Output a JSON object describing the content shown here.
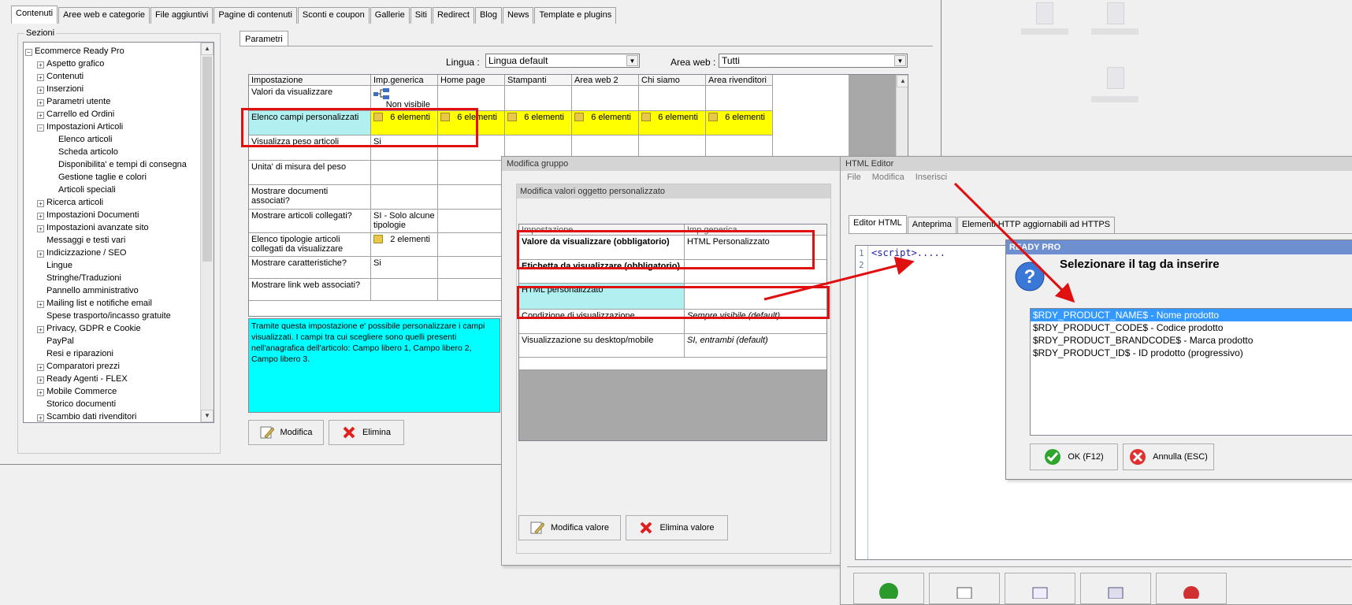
{
  "main": {
    "tabs": [
      "Contenuti",
      "Aree web e categorie",
      "File aggiuntivi",
      "Pagine di contenuti",
      "Sconti e coupon",
      "Gallerie",
      "Siti",
      "Redirect",
      "Blog",
      "News",
      "Template e plugins"
    ],
    "sections_label": "Sezioni",
    "tree": [
      {
        "label": "Ecommerce Ready Pro",
        "level": 0,
        "exp": "-"
      },
      {
        "label": "Aspetto grafico",
        "level": 1,
        "exp": "+"
      },
      {
        "label": "Contenuti",
        "level": 1,
        "exp": "+"
      },
      {
        "label": "Inserzioni",
        "level": 1,
        "exp": "+"
      },
      {
        "label": "Parametri utente",
        "level": 1,
        "exp": "+"
      },
      {
        "label": "Carrello ed Ordini",
        "level": 1,
        "exp": "+"
      },
      {
        "label": "Impostazioni Articoli",
        "level": 1,
        "exp": "-"
      },
      {
        "label": "Elenco articoli",
        "level": 2,
        "exp": ""
      },
      {
        "label": "Scheda articolo",
        "level": 2,
        "exp": ""
      },
      {
        "label": "Disponibilita' e tempi di consegna",
        "level": 2,
        "exp": ""
      },
      {
        "label": "Gestione taglie e colori",
        "level": 2,
        "exp": ""
      },
      {
        "label": "Articoli speciali",
        "level": 2,
        "exp": ""
      },
      {
        "label": "Ricerca articoli",
        "level": 1,
        "exp": "+"
      },
      {
        "label": "Impostazioni Documenti",
        "level": 1,
        "exp": "+"
      },
      {
        "label": "Impostazioni avanzate sito",
        "level": 1,
        "exp": "+"
      },
      {
        "label": "Messaggi e testi vari",
        "level": 1,
        "exp": ""
      },
      {
        "label": "Indicizzazione / SEO",
        "level": 1,
        "exp": "+"
      },
      {
        "label": "Lingue",
        "level": 1,
        "exp": ""
      },
      {
        "label": "Stringhe/Traduzioni",
        "level": 1,
        "exp": ""
      },
      {
        "label": "Pannello amministrativo",
        "level": 1,
        "exp": ""
      },
      {
        "label": "Mailing list e notifiche email",
        "level": 1,
        "exp": "+"
      },
      {
        "label": "Spese trasporto/incasso gratuite",
        "level": 1,
        "exp": ""
      },
      {
        "label": "Privacy, GDPR e Cookie",
        "level": 1,
        "exp": "+"
      },
      {
        "label": "PayPal",
        "level": 1,
        "exp": ""
      },
      {
        "label": "Resi e riparazioni",
        "level": 1,
        "exp": ""
      },
      {
        "label": "Comparatori prezzi",
        "level": 1,
        "exp": "+"
      },
      {
        "label": "Ready Agenti - FLEX",
        "level": 1,
        "exp": "+"
      },
      {
        "label": "Mobile Commerce",
        "level": 1,
        "exp": "+"
      },
      {
        "label": "Storico documenti",
        "level": 1,
        "exp": ""
      },
      {
        "label": "Scambio dati rivenditori",
        "level": 1,
        "exp": "+"
      }
    ],
    "params_tab": "Parametri",
    "lingua_label": "Lingua :",
    "lingua_value": "Lingua default",
    "area_label": "Area web :",
    "area_value": "Tutti",
    "grid_headers": [
      "Impostazione",
      "Imp.generica",
      "Home page",
      "Stampanti",
      "Area web 2",
      "Chi siamo",
      "Area rivenditori"
    ],
    "grid_rows": [
      {
        "name": "Valori da visualizzare",
        "generic": "Non visibile"
      },
      {
        "name": "Elenco campi personalizzati",
        "generic": "6 elementi",
        "cols": [
          "6 elementi",
          "6 elementi",
          "6 elementi",
          "6 elementi",
          "6 elementi"
        ]
      },
      {
        "name": "Visualizza peso articoli",
        "generic": "Si"
      },
      {
        "name": "Unita' di misura del peso",
        "generic": ""
      },
      {
        "name": "Mostrare documenti associati?",
        "generic": ""
      },
      {
        "name": "Mostrare articoli collegati?",
        "generic": "SI - Solo alcune tipologie"
      },
      {
        "name": "Elenco tipologie articoli collegati da visualizzare",
        "generic": "2 elementi"
      },
      {
        "name": "Mostrare caratteristiche?",
        "generic": "Si"
      },
      {
        "name": "Mostrare link web associati?",
        "generic": ""
      }
    ],
    "description": "Tramite questa impostazione e' possibile personalizzare i campi visualizzati. I campi tra cui scegliere sono quelli presenti nell'anagrafica dell'articolo: Campo libero 1, Campo libero 2, Campo libero 3.",
    "modify_btn": "Modifica",
    "delete_btn": "Elimina"
  },
  "group_dialog": {
    "title": "Modifica gruppo",
    "inner_title": "Modifica valori oggetto personalizzato",
    "headers": [
      "Impostazione",
      "Imp.generica"
    ],
    "rows": [
      {
        "name": "Valore da visualizzare (obbligatorio)",
        "value": "HTML Personalizzato"
      },
      {
        "name": "Etichetta da visualizzare (obbligatorio)",
        "value": ""
      },
      {
        "name": "HTML personalizzato",
        "value": ""
      },
      {
        "name": "Condizione di visualizzazione",
        "value": "Sempre visibile (default)"
      },
      {
        "name": "Visualizzazione su desktop/mobile",
        "value": "SI, entrambi (default)"
      }
    ],
    "modify_value_btn": "Modifica valore",
    "delete_value_btn": "Elimina valore"
  },
  "html_editor": {
    "title": "HTML Editor",
    "menu": [
      "File",
      "Modifica",
      "Inserisci"
    ],
    "tabs": [
      "Editor HTML",
      "Anteprima",
      "Elementi HTTP aggiornabili ad HTTPS"
    ],
    "line_numbers": [
      "1",
      "2"
    ],
    "code": "<script>....."
  },
  "tag_dialog": {
    "title": "READY PRO",
    "heading": "Selezionare il tag da inserire",
    "options": [
      "$RDY_PRODUCT_NAME$ - Nome prodotto",
      "$RDY_PRODUCT_CODE$ - Codice prodotto",
      "$RDY_PRODUCT_BRANDCODE$ - Marca prodotto",
      "$RDY_PRODUCT_ID$ - ID prodotto (progressivo)"
    ],
    "ok_btn": "OK (F12)",
    "cancel_btn": "Annulla (ESC)"
  },
  "colors": {
    "highlight": "#b0f0f0",
    "yellow": "#ffff00",
    "cyan": "#00ffff",
    "red": "#e01010",
    "selected": "#3399ff"
  }
}
